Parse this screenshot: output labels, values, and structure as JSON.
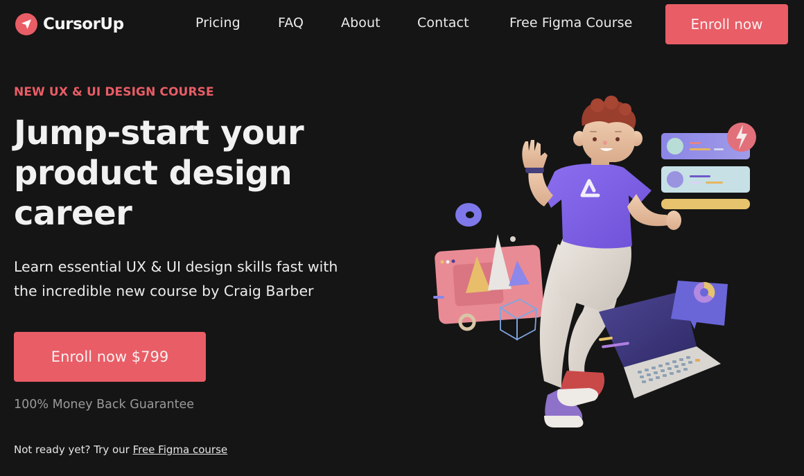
{
  "brand": {
    "name": "CursorUp",
    "logo_icon": "paper-plane-cursor-icon",
    "accent_color": "#e95d66",
    "background_color": "#151515"
  },
  "nav": {
    "links": [
      {
        "label": "Pricing"
      },
      {
        "label": "FAQ"
      },
      {
        "label": "About"
      },
      {
        "label": "Contact"
      },
      {
        "label": "Free Figma Course"
      }
    ],
    "cta_label": "Enroll now"
  },
  "hero": {
    "eyebrow": "NEW UX & UI DESIGN COURSE",
    "headline_lines": [
      "Jump-start your",
      "product design",
      "career"
    ],
    "subhead_lines": [
      "Learn essential UX & UI design skills fast with",
      "the incredible new course by Craig Barber"
    ],
    "cta_label": "Enroll now $799",
    "guarantee": "100% Money Back Guarantee",
    "secondary_prefix": "Not ready yet? Try our ",
    "secondary_link": "Free Figma course"
  },
  "illustration": {
    "description": "3D character waving with floating UI cards, chart window and laptop",
    "shirt_logo": "A"
  }
}
